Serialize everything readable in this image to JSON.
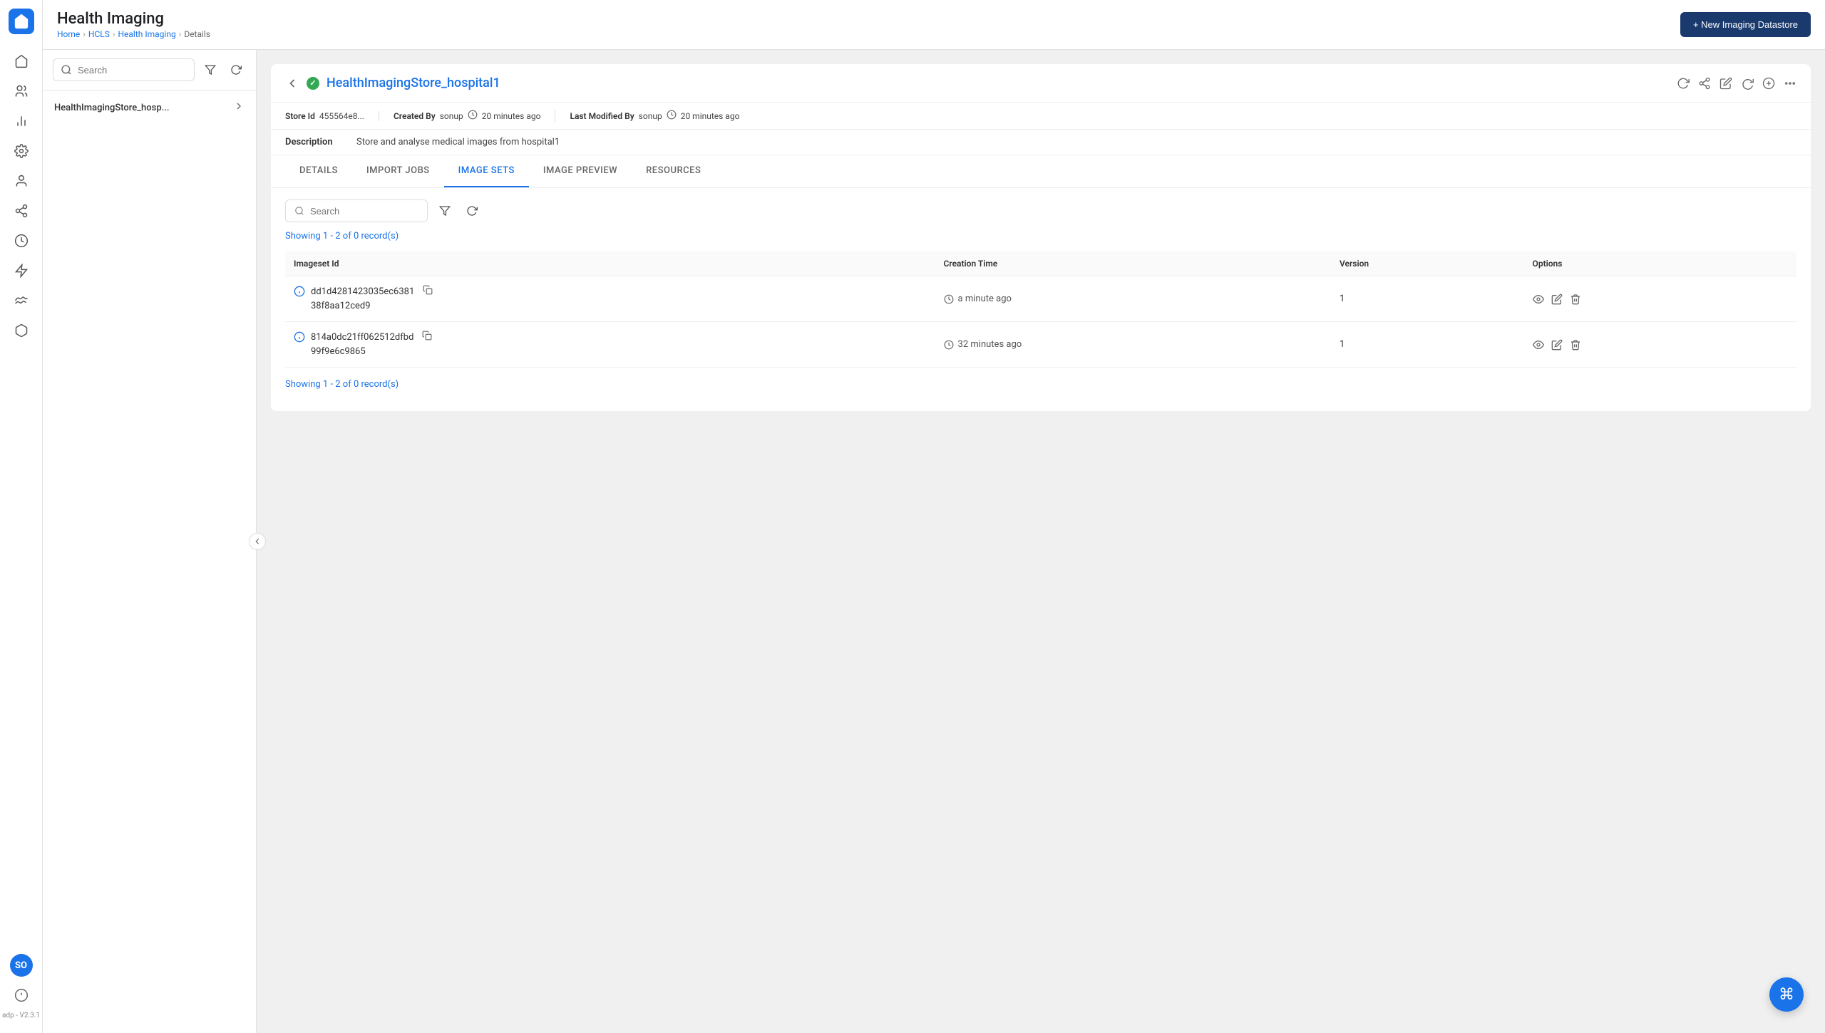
{
  "app": {
    "name": "Health Imaging",
    "logo_label": "ADP Logo"
  },
  "breadcrumb": {
    "items": [
      "Home",
      "HCLS",
      "Health Imaging",
      "Details"
    ]
  },
  "new_button": {
    "label": "+ New Imaging Datastore"
  },
  "sidebar": {
    "icons": [
      {
        "name": "home-icon",
        "symbol": "⌂"
      },
      {
        "name": "users-icon",
        "symbol": "👤"
      },
      {
        "name": "analytics-icon",
        "symbol": "📊"
      },
      {
        "name": "settings-icon",
        "symbol": "⚙"
      },
      {
        "name": "person-icon",
        "symbol": "👤"
      },
      {
        "name": "share-icon",
        "symbol": "🔗"
      },
      {
        "name": "clock-icon",
        "symbol": "🕐"
      },
      {
        "name": "lightning-icon",
        "symbol": "⚡"
      },
      {
        "name": "wave-icon",
        "symbol": "〰"
      },
      {
        "name": "box-icon",
        "symbol": "📦"
      }
    ],
    "avatar": "SO",
    "version": "adp - V2.3.1"
  },
  "left_panel": {
    "search_placeholder": "Search",
    "items": [
      {
        "label": "HealthImagingStore_hosp...",
        "id": "store-item-1"
      }
    ]
  },
  "store_detail": {
    "name": "HealthImagingStore_hospital1",
    "status": "active",
    "store_id_label": "Store Id",
    "store_id": "455564e8...",
    "created_by_label": "Created By",
    "created_by_user": "sonup",
    "created_at": "20 minutes ago",
    "last_modified_label": "Last Modified By",
    "last_modified_user": "sonup",
    "last_modified_at": "20 minutes ago",
    "description_label": "Description",
    "description": "Store and analyse medical images from hospital1"
  },
  "tabs": [
    {
      "id": "details",
      "label": "DETAILS"
    },
    {
      "id": "import-jobs",
      "label": "IMPORT JOBS"
    },
    {
      "id": "imagesets",
      "label": "IMAGE SETS",
      "active": true
    },
    {
      "id": "image-preview",
      "label": "IMAGE PREVIEW"
    },
    {
      "id": "resources",
      "label": "RESOURCES"
    }
  ],
  "imagesets": {
    "search_placeholder": "Search",
    "record_count_top": "Showing 1 - 2 of 0 record(s)",
    "record_count_bottom": "Showing 1 - 2 of 0 record(s)",
    "columns": [
      "Imageset Id",
      "Creation Time",
      "Version",
      "Options"
    ],
    "rows": [
      {
        "id_line1": "dd1d4281423035ec6381",
        "id_line2": "38f8aa12ced9",
        "creation_time": "a minute ago",
        "version": "1"
      },
      {
        "id_line1": "814a0dc21ff062512dfbd",
        "id_line2": "99f9e6c9865",
        "creation_time": "32 minutes ago",
        "version": "1"
      }
    ]
  },
  "fab": {
    "icon": "⌘",
    "label": "Command"
  }
}
